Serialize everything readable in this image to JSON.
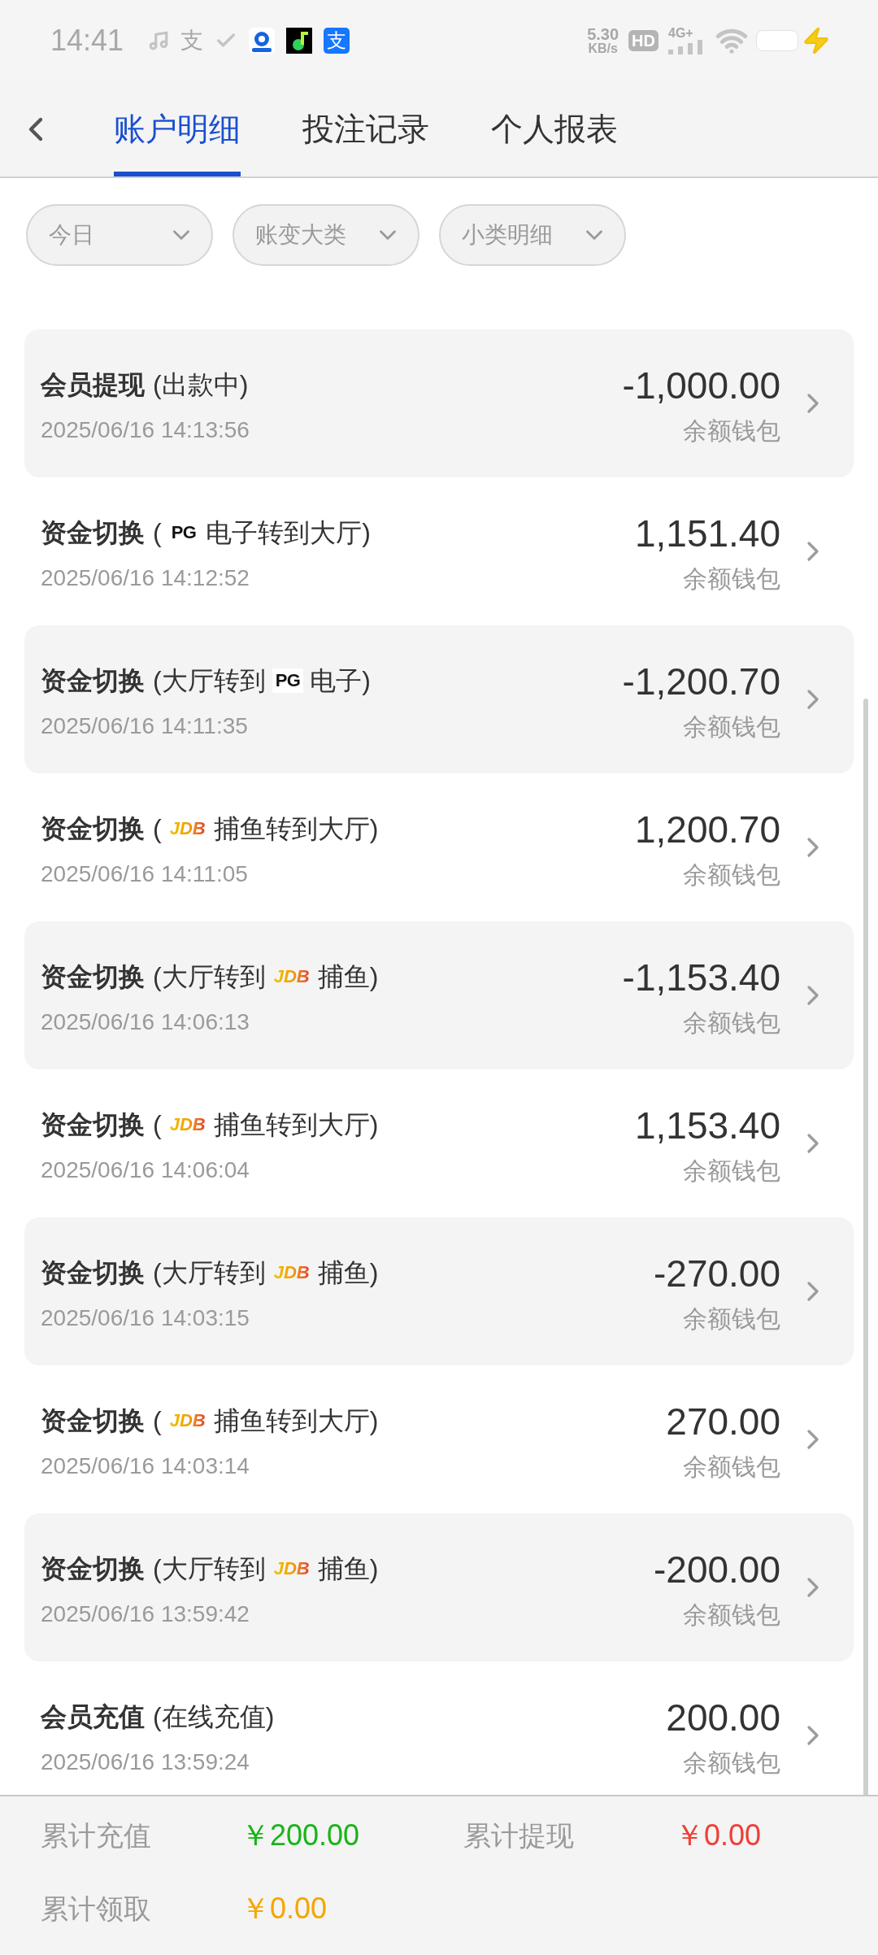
{
  "status_bar": {
    "time": "14:41",
    "notification_glyph": "支",
    "app_glyph": "支",
    "net_speed": "5.30",
    "net_unit": "KB/s",
    "hd": "HD",
    "network": "4G+"
  },
  "tabs": [
    {
      "label": "账户明细",
      "selected": true
    },
    {
      "label": "投注记录",
      "selected": false
    },
    {
      "label": "个人报表",
      "selected": false
    }
  ],
  "filters": [
    "今日",
    "账变大类",
    "小类明细"
  ],
  "entries": [
    {
      "title": "会员提现",
      "note": [
        {
          "kind": "text",
          "text": "(出款中)"
        }
      ],
      "time": "2025/06/16 14:13:56",
      "amount": "-1,000.00",
      "wallet": "余额钱包"
    },
    {
      "title": "资金切换",
      "note": [
        {
          "kind": "text",
          "text": "("
        },
        {
          "kind": "pg_logo",
          "text": "PG"
        },
        {
          "kind": "text",
          "text": "电子转到大厅)"
        }
      ],
      "time": "2025/06/16 14:12:52",
      "amount": "1,151.40",
      "wallet": "余额钱包"
    },
    {
      "title": "资金切换",
      "note": [
        {
          "kind": "text",
          "text": "(大厅转到"
        },
        {
          "kind": "pg_logo",
          "text": "PG"
        },
        {
          "kind": "text",
          "text": "电子)"
        }
      ],
      "time": "2025/06/16 14:11:35",
      "amount": "-1,200.70",
      "wallet": "余额钱包"
    },
    {
      "title": "资金切换",
      "note": [
        {
          "kind": "text",
          "text": "("
        },
        {
          "kind": "jdb_logo",
          "text": "JDB"
        },
        {
          "kind": "text",
          "text": "捕鱼转到大厅)"
        }
      ],
      "time": "2025/06/16 14:11:05",
      "amount": "1,200.70",
      "wallet": "余额钱包"
    },
    {
      "title": "资金切换",
      "note": [
        {
          "kind": "text",
          "text": "(大厅转到"
        },
        {
          "kind": "jdb_logo",
          "text": "JDB"
        },
        {
          "kind": "text",
          "text": "捕鱼)"
        }
      ],
      "time": "2025/06/16 14:06:13",
      "amount": "-1,153.40",
      "wallet": "余额钱包"
    },
    {
      "title": "资金切换",
      "note": [
        {
          "kind": "text",
          "text": "("
        },
        {
          "kind": "jdb_logo",
          "text": "JDB"
        },
        {
          "kind": "text",
          "text": "捕鱼转到大厅)"
        }
      ],
      "time": "2025/06/16 14:06:04",
      "amount": "1,153.40",
      "wallet": "余额钱包"
    },
    {
      "title": "资金切换",
      "note": [
        {
          "kind": "text",
          "text": "(大厅转到"
        },
        {
          "kind": "jdb_logo",
          "text": "JDB"
        },
        {
          "kind": "text",
          "text": "捕鱼)"
        }
      ],
      "time": "2025/06/16 14:03:15",
      "amount": "-270.00",
      "wallet": "余额钱包"
    },
    {
      "title": "资金切换",
      "note": [
        {
          "kind": "text",
          "text": "("
        },
        {
          "kind": "jdb_logo",
          "text": "JDB"
        },
        {
          "kind": "text",
          "text": "捕鱼转到大厅)"
        }
      ],
      "time": "2025/06/16 14:03:14",
      "amount": "270.00",
      "wallet": "余额钱包"
    },
    {
      "title": "资金切换",
      "note": [
        {
          "kind": "text",
          "text": "(大厅转到"
        },
        {
          "kind": "jdb_logo",
          "text": "JDB"
        },
        {
          "kind": "text",
          "text": "捕鱼)"
        }
      ],
      "time": "2025/06/16 13:59:42",
      "amount": "-200.00",
      "wallet": "余额钱包"
    },
    {
      "title": "会员充值",
      "note": [
        {
          "kind": "text",
          "text": "(在线充值)"
        }
      ],
      "time": "2025/06/16 13:59:24",
      "amount": "200.00",
      "wallet": "余额钱包"
    }
  ],
  "summary": [
    {
      "label": "累计充值",
      "value": "￥200.00",
      "color": "#18b418"
    },
    {
      "label": "累计提现",
      "value": "￥0.00",
      "color": "#ee4036"
    },
    {
      "label": "累计领取",
      "value": "￥0.00",
      "color": "#f5a500"
    }
  ]
}
